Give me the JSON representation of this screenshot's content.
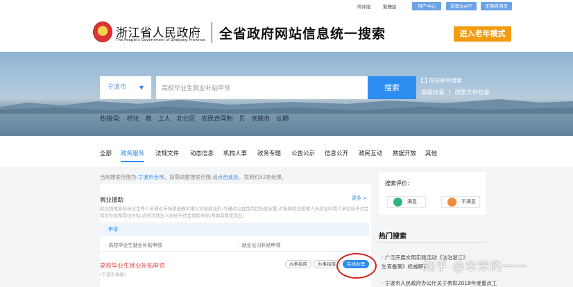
{
  "topbar": {
    "simplified": "简体版",
    "traditional": "繁體版",
    "btn1": "用户中心",
    "btn2": "浙里办APP",
    "btn3": "无障碍浏览"
  },
  "header": {
    "brand_cn": "浙江省人民政府",
    "brand_en": "The People's Government of Zhejiang Province",
    "title": "全省政府网站信息统一搜索",
    "elder_mode": "进入老年模式"
  },
  "search": {
    "region": "宁波市",
    "query": "高校毕业生就业补贴申领",
    "button": "搜索",
    "in_result": "在结果中搜索",
    "advanced": "高级检索",
    "sep": "|",
    "policy_search": "政策文件检索",
    "hot_label": "热搜词:",
    "hot_words": [
      "桥化",
      "稳",
      "工人",
      "北仑区",
      "农民合同制",
      "贝",
      "余姚市",
      "长期"
    ]
  },
  "nav": {
    "items": [
      "全部",
      "政务服务",
      "法规文件",
      "动态信息",
      "机构人事",
      "政务专题",
      "公告公示",
      "信息公开",
      "政民互动",
      "数据开放",
      "其他"
    ],
    "active_index": 1
  },
  "scope": {
    "prefix": "当前搜索范围为:",
    "region": "宁波市全市",
    "middle": "。如需调整搜索范围,请",
    "link": "点击此处",
    "suffix": "。找到约52条结果。"
  },
  "result": {
    "section_title": "就业援助",
    "more": "更多 >",
    "description": "就业困难高校毕业生等人员通过市场渠道确实难以实现就业的,可通过公益性岗位托底安置,对吸纳就业困难人员就业的用人单位给予社会保险补贴和岗位补贴,对灵活就业人员给予社会保险补贴,帮助其稳定就业。",
    "subtab": "申请",
    "item1": "· 高校毕业生就业补贴申领",
    "item2": "· 就业见习补贴申领",
    "title": "高校毕业生就业补贴申领",
    "subtitle": "(宁波市本级)",
    "tag1": "办事指南",
    "tag2": "办事指南",
    "tag3": "在线办理"
  },
  "sidebar": {
    "eval_title": "搜索评价:",
    "satisfied": "满意",
    "unsatisfied": "不满意",
    "hot_title": "热门搜索",
    "hot_items": [
      "· 广泛开展文明实践活动《法治浙江》",
      "生育备案》权威解读",
      "· 宁波市人民政府办公厅关于表彰2018年度重点工"
    ]
  },
  "watermark": "知乎 @笨笨的一一"
}
